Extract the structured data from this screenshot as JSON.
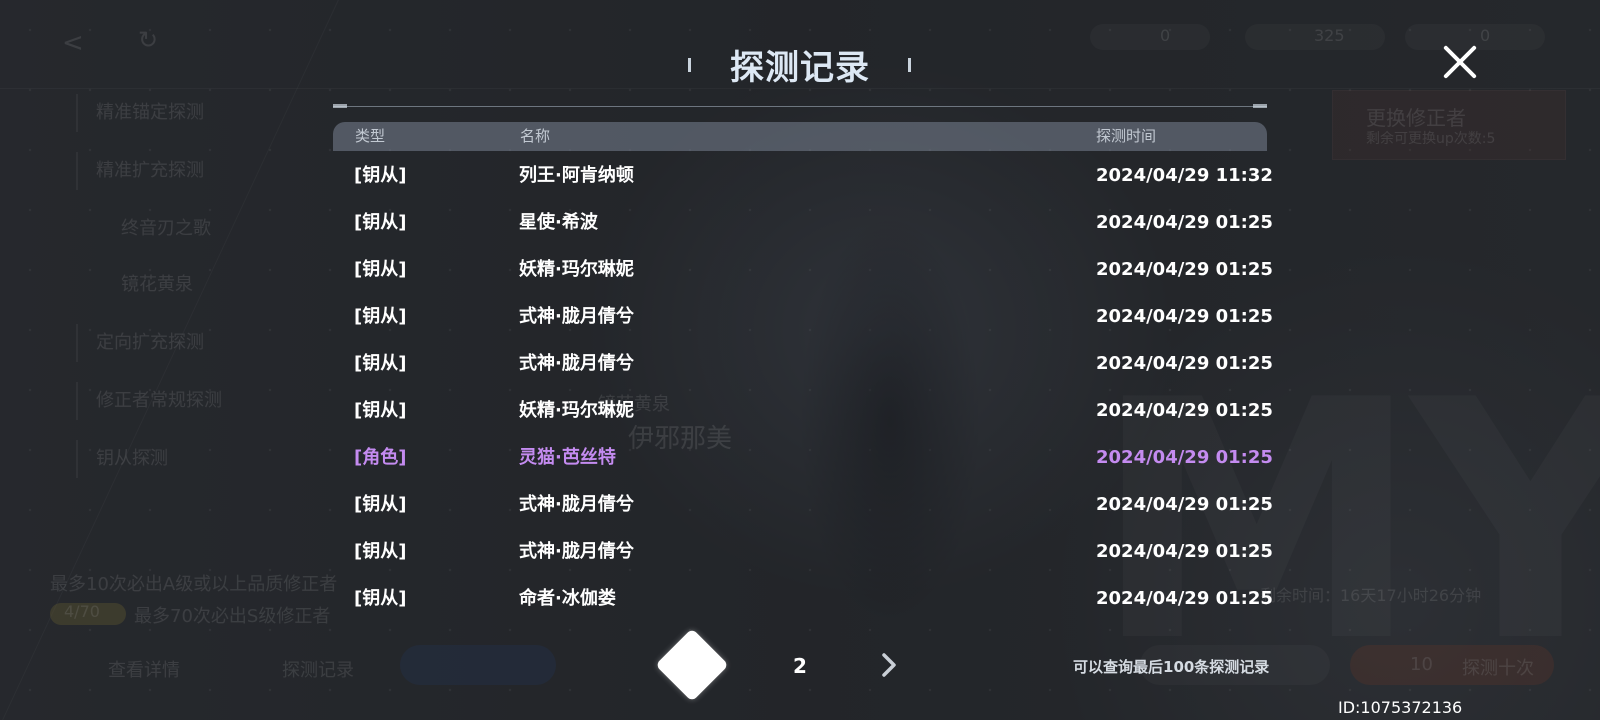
{
  "dialog": {
    "title": "探测记录",
    "columns": {
      "type": "类型",
      "name": "名称",
      "time": "探测时间"
    },
    "rows": [
      {
        "type": "[钥从]",
        "name": "列王·阿肯纳顿",
        "time": "2024/04/29 11:32",
        "highlight": false
      },
      {
        "type": "[钥从]",
        "name": "星使·希波",
        "time": "2024/04/29 01:25",
        "highlight": false
      },
      {
        "type": "[钥从]",
        "name": "妖精·玛尔琳妮",
        "time": "2024/04/29 01:25",
        "highlight": false
      },
      {
        "type": "[钥从]",
        "name": "式神·胧月倩兮",
        "time": "2024/04/29 01:25",
        "highlight": false
      },
      {
        "type": "[钥从]",
        "name": "式神·胧月倩兮",
        "time": "2024/04/29 01:25",
        "highlight": false
      },
      {
        "type": "[钥从]",
        "name": "妖精·玛尔琳妮",
        "time": "2024/04/29 01:25",
        "highlight": false
      },
      {
        "type": "[角色]",
        "name": "灵猫·芭丝特",
        "time": "2024/04/29 01:25",
        "highlight": true
      },
      {
        "type": "[钥从]",
        "name": "式神·胧月倩兮",
        "time": "2024/04/29 01:25",
        "highlight": false
      },
      {
        "type": "[钥从]",
        "name": "式神·胧月倩兮",
        "time": "2024/04/29 01:25",
        "highlight": false
      },
      {
        "type": "[钥从]",
        "name": "命者·冰伽娄",
        "time": "2024/04/29 01:25",
        "highlight": false
      }
    ],
    "highlight_color": "#c48bf0",
    "pagination": {
      "page": "2"
    },
    "hint": "可以查询最后100条探测记录",
    "close_icon": "close-icon"
  },
  "footer": {
    "uid": "ID:1075372136"
  },
  "background": {
    "menu_items": [
      "精准锚定探测",
      "精准扩充探测",
      "终音刃之歌",
      "镜花黄泉",
      "定向扩充探测",
      "修正者常规探测",
      "钥从探测"
    ],
    "info_line1": "最多10次必出A级或以上品质修正者",
    "badge": "4/70",
    "info_line2": "最多70次必出S级修正者",
    "bottom_items": [
      "查看详情",
      "探测记录"
    ],
    "side_card_title": "更换修正者",
    "side_card_sub": "剩余可更换up次数:5",
    "timer": "剩余时间：16天17小时26分钟",
    "char_name": "伊邪那美",
    "char_tag": "镜花黄泉",
    "top_counts": [
      "0",
      "325",
      "0"
    ],
    "btn_ten": "探测十次",
    "btn_ten_cost": "10"
  }
}
